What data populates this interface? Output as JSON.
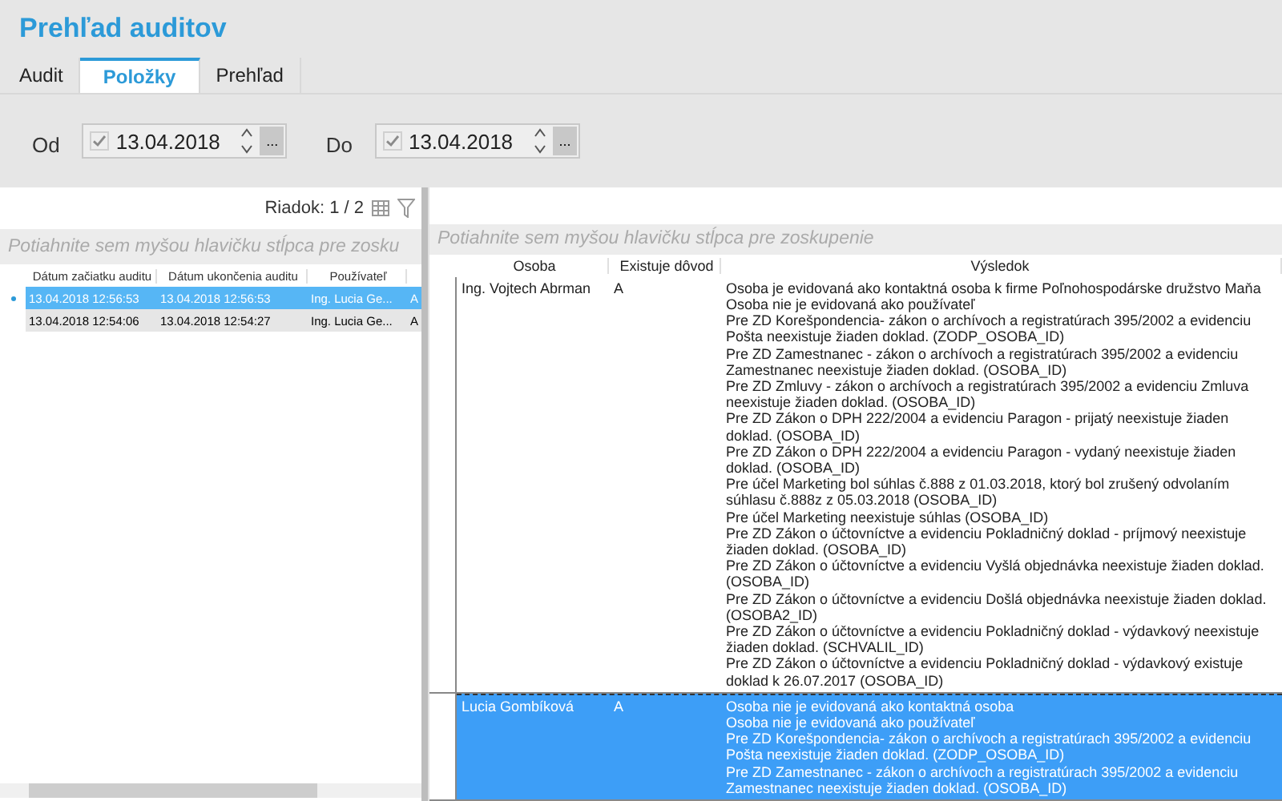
{
  "title": "Prehľad auditov",
  "tabs": [
    {
      "label": "Audit",
      "selected": false
    },
    {
      "label": "Položky",
      "selected": true
    },
    {
      "label": "Prehľad",
      "selected": false
    }
  ],
  "filters": [
    {
      "label": "Od",
      "checked": true,
      "value": "13.04.2018",
      "button": "..."
    },
    {
      "label": "Do",
      "checked": true,
      "value": "13.04.2018",
      "button": "..."
    }
  ],
  "left_grid": {
    "row_counter": "Riadok: 1 / 2",
    "group_hint": "Potiahnite sem myšou hlavičku stĺpca pre zosku",
    "columns": [
      "Dátum začiatku auditu",
      "Dátum ukončenia auditu",
      "Používateľ"
    ],
    "rows": [
      {
        "selected": true,
        "cells": [
          "13.04.2018 12:56:53",
          "13.04.2018 12:56:53",
          "Ing. Lucia Ge...",
          "A"
        ]
      },
      {
        "selected": false,
        "cells": [
          "13.04.2018 12:54:06",
          "13.04.2018 12:54:27",
          "Ing. Lucia Ge...",
          "A"
        ]
      }
    ]
  },
  "right_grid": {
    "group_hint": "Potiahnite sem myšou hlavičku stĺpca pre zoskupenie",
    "columns": [
      "Osoba",
      "Existuje dôvod",
      "Výsledok"
    ],
    "rows": [
      {
        "selected": false,
        "person": "Ing. Vojtech Abrman",
        "reason": "A",
        "results": [
          "Osoba je evidovaná ako kontaktná osoba k firme Poľnohospodárske družstvo Maňa",
          "Osoba nie je evidovaná ako používateľ",
          "Pre ZD Korešpondencia- zákon o archívoch a registratúrach 395/2002 a evidenciu Pošta neexistuje žiaden doklad. (ZODP_OSOBA_ID)",
          "Pre ZD Zamestnanec - zákon o archívoch a registratúrach 395/2002 a evidenciu Zamestnanec neexistuje žiaden doklad. (OSOBA_ID)",
          "Pre ZD Zmluvy - zákon o archívoch a registratúrach 395/2002 a evidenciu Zmluva neexistuje žiaden doklad. (OSOBA_ID)",
          "Pre ZD Zákon o DPH 222/2004 a evidenciu Paragon - prijatý neexistuje žiaden doklad. (OSOBA_ID)",
          "Pre ZD Zákon o DPH 222/2004 a evidenciu Paragon - vydaný neexistuje žiaden doklad. (OSOBA_ID)",
          "Pre účel Marketing bol súhlas č.888 z 01.03.2018, ktorý bol zrušený odvolaním súhlasu č.888z z 05.03.2018 (OSOBA_ID)",
          "Pre účel Marketing neexistuje súhlas (OSOBA_ID)",
          "Pre ZD Zákon o účtovníctve a evidenciu Pokladničný doklad - príjmový neexistuje žiaden doklad. (OSOBA_ID)",
          "Pre ZD Zákon o účtovníctve a evidenciu Vyšlá objednávka neexistuje žiaden doklad. (OSOBA_ID)",
          "Pre ZD Zákon o účtovníctve a evidenciu Došlá objednávka neexistuje žiaden doklad. (OSOBA2_ID)",
          "Pre ZD Zákon o účtovníctve a evidenciu Pokladničný doklad - výdavkový neexistuje žiaden doklad. (SCHVALIL_ID)",
          "Pre ZD Zákon o účtovníctve a evidenciu Pokladničný doklad - výdavkový existuje doklad k 26.07.2017 (OSOBA_ID)"
        ]
      },
      {
        "selected": true,
        "person": "Lucia Gombíková",
        "reason": "A",
        "results": [
          "Osoba nie je evidovaná ako kontaktná osoba",
          "Osoba nie je evidovaná ako používateľ",
          "Pre ZD Korešpondencia- zákon o archívoch a registratúrach 395/2002 a evidenciu Pošta neexistuje žiaden doklad. (ZODP_OSOBA_ID)",
          "Pre ZD Zamestnanec - zákon o archívoch a registratúrach 395/2002 a evidenciu Zamestnanec neexistuje žiaden doklad. (OSOBA_ID)"
        ]
      }
    ]
  }
}
